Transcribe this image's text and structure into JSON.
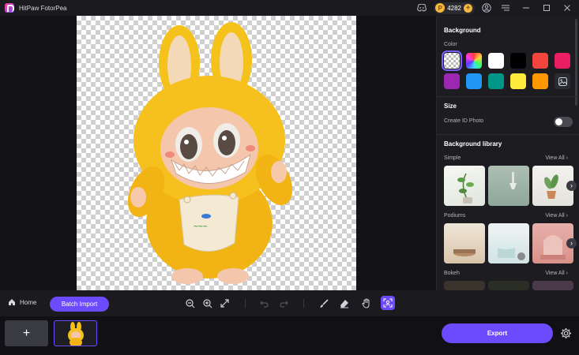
{
  "app": {
    "title": "HitPaw FotorPea",
    "credits": "4282"
  },
  "panel": {
    "background_title": "Background",
    "color_label": "Color",
    "colors": [
      "transparent",
      "rainbow",
      "#ffffff",
      "#000000",
      "#f2453d",
      "#e91e63",
      "#9c27b0",
      "#2196f3",
      "#009688",
      "#ffeb3b",
      "#ff9800",
      "image"
    ],
    "size_title": "Size",
    "id_photo_label": "Create ID Photo",
    "library_title": "Background library",
    "categories": [
      {
        "name": "Simple",
        "view_all": "View All"
      },
      {
        "name": "Podiums",
        "view_all": "View All"
      },
      {
        "name": "Bokeh",
        "view_all": "View All"
      }
    ]
  },
  "toolbar": {
    "home_label": "Home",
    "batch_label": "Batch Import"
  },
  "bottom": {
    "add_label": "+",
    "export_label": "Export"
  },
  "accent": "#6c4bff"
}
